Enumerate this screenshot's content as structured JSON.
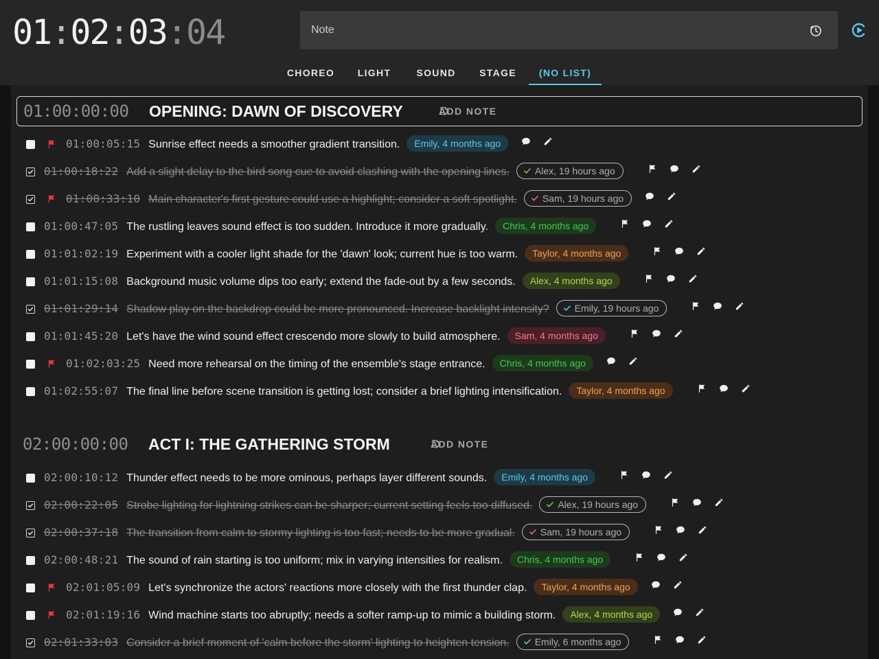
{
  "header": {
    "timecode": {
      "h": "01",
      "m": "02",
      "s": "03",
      "f": "04",
      "sep": ":"
    },
    "note_placeholder": "Note"
  },
  "tabs": [
    {
      "label": "CHOREO",
      "active": false
    },
    {
      "label": "LIGHT",
      "active": false
    },
    {
      "label": "SOUND",
      "active": false
    },
    {
      "label": "STAGE",
      "active": false
    },
    {
      "label": "(NO LIST)",
      "active": true
    }
  ],
  "colors": {
    "accent": "#5bc8ec",
    "flag": "#e53935",
    "check_green": "#6fcf4a",
    "check_blue": "#5bc8ec",
    "check_pink": "#ec6a8a",
    "badge_emily": {
      "bg": "#1e3a45",
      "fg": "#5bc8ec"
    },
    "badge_chris": {
      "bg": "#1d3a1d",
      "fg": "#43c94f"
    },
    "badge_taylor": {
      "bg": "#4a2e1a",
      "fg": "#f2a052"
    },
    "badge_alex": {
      "bg": "#33401c",
      "fg": "#b5d84a"
    },
    "badge_sam": {
      "bg": "#4a1f2a",
      "fg": "#f07a93"
    }
  },
  "add_note_label": "ADD NOTE",
  "scenes": [
    {
      "timecode": "01:00:00:00",
      "title": "OPENING: DAWN OF DISCOVERY",
      "notes": [
        {
          "tc": "01:00:05:15",
          "text": "Sunrise effect needs a smoother gradient transition.",
          "badge": "Emily, 4 months ago",
          "author": "emily",
          "done": false,
          "flag": true
        },
        {
          "tc": "01:00:18:22",
          "text": "Add a slight delay to the bird song cue to avoid clashing with the opening lines.",
          "badge": "Alex, 19 hours ago",
          "author": "alex",
          "done": true,
          "flag": false
        },
        {
          "tc": "01:00:33:10",
          "text": "Main character's first gesture could use a highlight; consider a soft spotlight.",
          "badge": "Sam, 19 hours ago",
          "author": "sam",
          "done": true,
          "flag": true
        },
        {
          "tc": "01:00:47:05",
          "text": "The rustling leaves sound effect is too sudden. Introduce it more gradually.",
          "badge": "Chris, 4 months ago",
          "author": "chris",
          "done": false,
          "flag": false
        },
        {
          "tc": "01:01:02:19",
          "text": "Experiment with a cooler light shade for the 'dawn' look; current hue is too warm.",
          "badge": "Taylor, 4 months ago",
          "author": "taylor",
          "done": false,
          "flag": false
        },
        {
          "tc": "01:01:15:08",
          "text": "Background music volume dips too early; extend the fade-out by a few seconds.",
          "badge": "Alex, 4 months ago",
          "author": "alex",
          "done": false,
          "flag": false
        },
        {
          "tc": "01:01:29:14",
          "text": "Shadow play on the backdrop could be more pronounced. Increase backlight intensity?",
          "badge": "Emily, 19 hours ago",
          "author": "emily",
          "done": true,
          "flag": false
        },
        {
          "tc": "01:01:45:20",
          "text": "Let's have the wind sound effect crescendo more slowly to build atmosphere.",
          "badge": "Sam, 4 months ago",
          "author": "sam",
          "done": false,
          "flag": false
        },
        {
          "tc": "01:02:03:25",
          "text": "Need more rehearsal on the timing of the ensemble's stage entrance.",
          "badge": "Chris, 4 months ago",
          "author": "chris",
          "done": false,
          "flag": true
        },
        {
          "tc": "01:02:55:07",
          "text": "The final line before scene transition is getting lost; consider a brief lighting intensification.",
          "badge": "Taylor, 4 months ago",
          "author": "taylor",
          "done": false,
          "flag": false
        }
      ]
    },
    {
      "timecode": "02:00:00:00",
      "title": "ACT I: THE GATHERING STORM",
      "notes": [
        {
          "tc": "02:00:10:12",
          "text": "Thunder effect needs to be more ominous, perhaps layer different sounds.",
          "badge": "Emily, 4 months ago",
          "author": "emily",
          "done": false,
          "flag": false
        },
        {
          "tc": "02:00:22:05",
          "text": "Strobe lighting for lightning strikes can be sharper; current setting feels too diffused.",
          "badge": "Alex, 19 hours ago",
          "author": "alex",
          "done": true,
          "flag": false
        },
        {
          "tc": "02:00:37:18",
          "text": "The transition from calm to stormy lighting is too fast; needs to be more gradual.",
          "badge": "Sam, 19 hours ago",
          "author": "sam",
          "done": true,
          "flag": false
        },
        {
          "tc": "02:00:48:21",
          "text": "The sound of rain starting is too uniform; mix in varying intensities for realism.",
          "badge": "Chris, 4 months ago",
          "author": "chris",
          "done": false,
          "flag": false
        },
        {
          "tc": "02:01:05:09",
          "text": "Let's synchronize the actors' reactions more closely with the first thunder clap.",
          "badge": "Taylor, 4 months ago",
          "author": "taylor",
          "done": false,
          "flag": true
        },
        {
          "tc": "02:01:19:16",
          "text": "Wind machine starts too abruptly; needs a softer ramp-up to mimic a building storm.",
          "badge": "Alex, 4 months ago",
          "author": "alex",
          "done": false,
          "flag": true
        },
        {
          "tc": "02:01:33:03",
          "text": "Consider a brief moment of 'calm before the storm' lighting to heighten tension.",
          "badge": "Emily, 6 months ago",
          "author": "emily",
          "done": true,
          "flag": false
        }
      ]
    }
  ]
}
